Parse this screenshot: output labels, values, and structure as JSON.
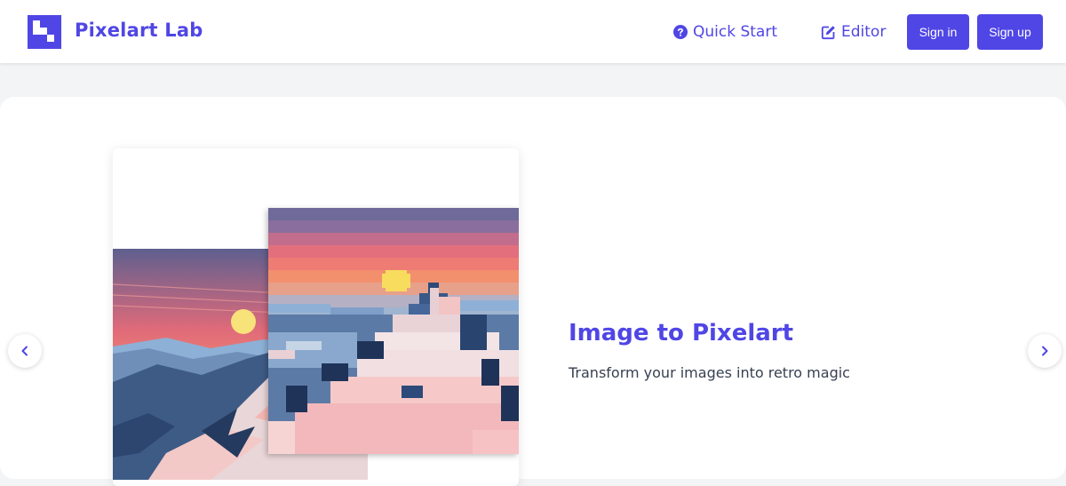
{
  "header": {
    "brand_name": "Pixelart Lab",
    "logo_icon": "pixel-logo-icon",
    "nav": {
      "quick_start_label": "Quick Start",
      "quick_start_icon": "question-circle-icon",
      "editor_label": "Editor",
      "editor_icon": "edit-pencil-icon"
    },
    "sign_in_label": "Sign in",
    "sign_up_label": "Sign up"
  },
  "hero": {
    "slide_title": "Image to Pixelart",
    "slide_subtitle": "Transform your images into retro magic",
    "prev_icon": "chevron-left-icon",
    "next_icon": "chevron-right-icon",
    "images": [
      {
        "name": "mountain-sunset-original-image"
      },
      {
        "name": "mountain-sunset-pixelart-image"
      }
    ]
  },
  "colors": {
    "accent": "#4f46e5",
    "page_background": "#f3f4f6",
    "card_background": "#ffffff",
    "subtitle_text": "#374151"
  }
}
